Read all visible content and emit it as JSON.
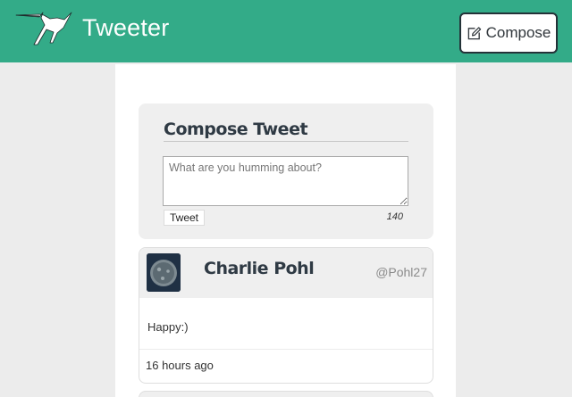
{
  "nav": {
    "title": "Tweeter",
    "compose_label": "Compose"
  },
  "compose": {
    "heading": "Compose Tweet",
    "placeholder": "What are you humming about?",
    "tweet_button": "Tweet",
    "counter": "140"
  },
  "tweets": [
    {
      "name": "Charlie Pohl",
      "handle": "@Pohl27",
      "content": "Happy:)",
      "time": "16 hours ago"
    }
  ],
  "colors": {
    "accent": "#33ab88",
    "page_background": "#ececec",
    "card_background": "#efefef",
    "button_border": "#243238"
  },
  "icons": {
    "logo": "hummingbird-logo",
    "compose": "pencil-square-icon",
    "avatar": "gray-sphere-avatar"
  }
}
